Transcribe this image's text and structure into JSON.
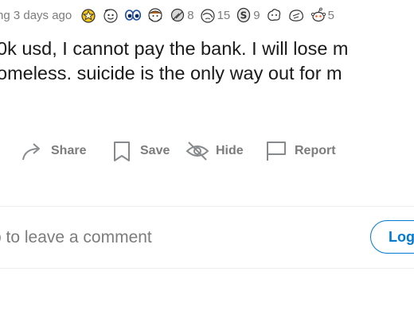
{
  "post": {
    "meta": {
      "time": "ng 3 days ago",
      "awards": [
        {
          "icon": "gold-medal-icon",
          "count": ""
        },
        {
          "icon": "wholesome-face-icon",
          "count": ""
        },
        {
          "icon": "eyes-icon",
          "count": ""
        },
        {
          "icon": "hugz-icon",
          "count": ""
        },
        {
          "icon": "silver-award-icon",
          "count": "8"
        },
        {
          "icon": "facepalm-icon",
          "count": "15"
        },
        {
          "icon": "coin-icon",
          "count": "9"
        },
        {
          "icon": "splash-icon",
          "count": ""
        },
        {
          "icon": "heart-hands-icon",
          "count": ""
        },
        {
          "icon": "snoo-icon",
          "count": "5"
        }
      ]
    },
    "body_lines": [
      "0k usd, I cannot pay the bank. I will lose m",
      "omeless. suicide is the only way out for m"
    ]
  },
  "actions": {
    "share": "Share",
    "save": "Save",
    "hide": "Hide",
    "report": "Report"
  },
  "comment": {
    "prompt": "p to leave a comment",
    "login": "Log In"
  }
}
